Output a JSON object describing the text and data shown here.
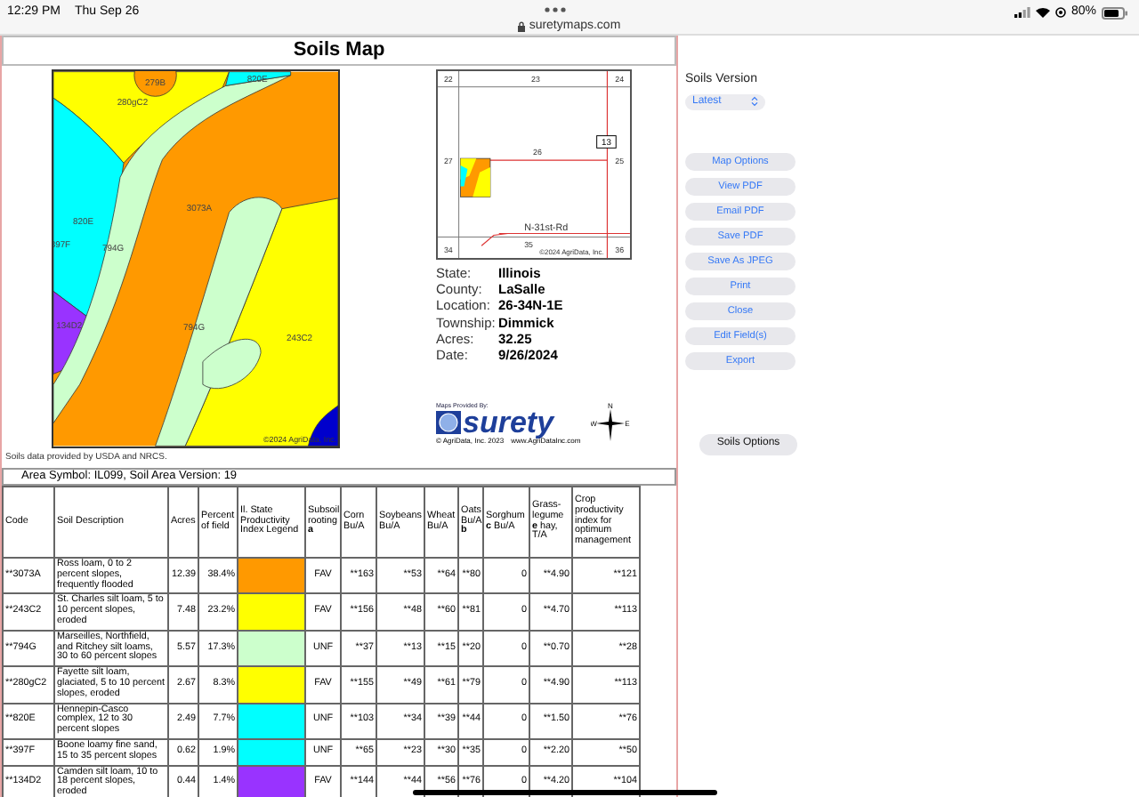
{
  "status_bar": {
    "time": "12:29 PM",
    "date": "Thu Sep 26",
    "url": "suretymaps.com",
    "battery": "80%"
  },
  "report": {
    "title": "Soils Map",
    "soil_map": {
      "labels": [
        "279B",
        "820E",
        "280gC2",
        "3073A",
        "820E",
        "397F",
        "794G",
        "794G",
        "134D2",
        "243C2"
      ],
      "copyright": "©2024 AgriData, Inc."
    },
    "locator_map": {
      "sections": [
        "22",
        "23",
        "24",
        "27",
        "26",
        "25",
        "34",
        "35",
        "36"
      ],
      "route_shield": "13",
      "road": "N-31st-Rd",
      "copyright": "©2024 AgriData, Inc."
    },
    "info": [
      {
        "label": "State:",
        "value": "Illinois"
      },
      {
        "label": "County:",
        "value": "LaSalle"
      },
      {
        "label": "Location:",
        "value": "26-34N-1E"
      },
      {
        "label": "Township:",
        "value": "Dimmick"
      },
      {
        "label": "Acres:",
        "value": "32.25"
      },
      {
        "label": "Date:",
        "value": "9/26/2024"
      }
    ],
    "logo": {
      "provided_by": "Maps Provided By:",
      "brand": "surety",
      "copyright": "© AgriData, Inc. 2023",
      "website": "www.AgriDataInc.com"
    },
    "compass": [
      "N",
      "W",
      "E"
    ],
    "source_note": "Soils data provided by USDA and NRCS.",
    "area_symbol": "Area Symbol: IL099, Soil Area Version: 19",
    "table": {
      "columns": [
        "Code",
        "Soil Description",
        "Acres",
        "Percent of field",
        "Il. State Productivity Index Legend",
        "Subsoil rooting **a**",
        "Corn Bu/A",
        "Soybeans Bu/A",
        "Wheat Bu/A",
        "Oats Bu/A **b**",
        "Sorghum **c** Bu/A",
        "Grass-legume **e** hay, T/A",
        "Crop productivity index for optimum management"
      ],
      "rows": [
        {
          "cells": [
            "**3073A",
            "Ross loam, 0 to 2 percent slopes, frequently flooded",
            "12.39",
            "38.4%"
          ],
          "color": "#ff9900",
          "ratings": [
            "FAV",
            "**163",
            "**53",
            "**64",
            "**80",
            "0",
            "**4.90",
            "**121"
          ]
        },
        {
          "cells": [
            "**243C2",
            "St. Charles silt loam, 5 to 10 percent slopes, eroded",
            "7.48",
            "23.2%"
          ],
          "color": "#ffff00",
          "ratings": [
            "FAV",
            "**156",
            "**48",
            "**60",
            "**81",
            "0",
            "**4.70",
            "**113"
          ]
        },
        {
          "cells": [
            "**794G",
            "Marseilles, Northfield, and Ritchey silt loams, 30 to 60 percent slopes",
            "5.57",
            "17.3%"
          ],
          "color": "#ccffcc",
          "ratings": [
            "UNF",
            "**37",
            "**13",
            "**15",
            "**20",
            "0",
            "**0.70",
            "**28"
          ]
        },
        {
          "cells": [
            "**280gC2",
            "Fayette silt loam, glaciated, 5 to 10 percent slopes, eroded",
            "2.67",
            "8.3%"
          ],
          "color": "#ffff00",
          "ratings": [
            "FAV",
            "**155",
            "**49",
            "**61",
            "**79",
            "0",
            "**4.90",
            "**113"
          ]
        },
        {
          "cells": [
            "**820E",
            "Hennepin-Casco complex, 12 to 30 percent slopes",
            "2.49",
            "7.7%"
          ],
          "color": "#00ffff",
          "ratings": [
            "UNF",
            "**103",
            "**34",
            "**39",
            "**44",
            "0",
            "**1.50",
            "**76"
          ]
        },
        {
          "cells": [
            "**397F",
            "Boone loamy fine sand, 15 to 35 percent slopes",
            "0.62",
            "1.9%"
          ],
          "color": "#00ffff",
          "ratings": [
            "UNF",
            "**65",
            "**23",
            "**30",
            "**35",
            "0",
            "**2.20",
            "**50"
          ]
        },
        {
          "cells": [
            "**134D2",
            "Camden silt loam, 10 to 18 percent slopes, eroded",
            "0.44",
            "1.4%"
          ],
          "color": "#9933ff",
          "ratings": [
            "FAV",
            "**144",
            "**44",
            "**56",
            "**76",
            "0",
            "**4.20",
            "**104"
          ]
        }
      ]
    }
  },
  "sidebar": {
    "version_label": "Soils Version",
    "version_select": "Latest",
    "buttons": [
      "Map Options",
      "View PDF",
      "Email PDF",
      "Save PDF",
      "Save As JPEG",
      "Print",
      "Close",
      "Edit Field(s)",
      "Export"
    ],
    "options_button": "Soils Options"
  }
}
